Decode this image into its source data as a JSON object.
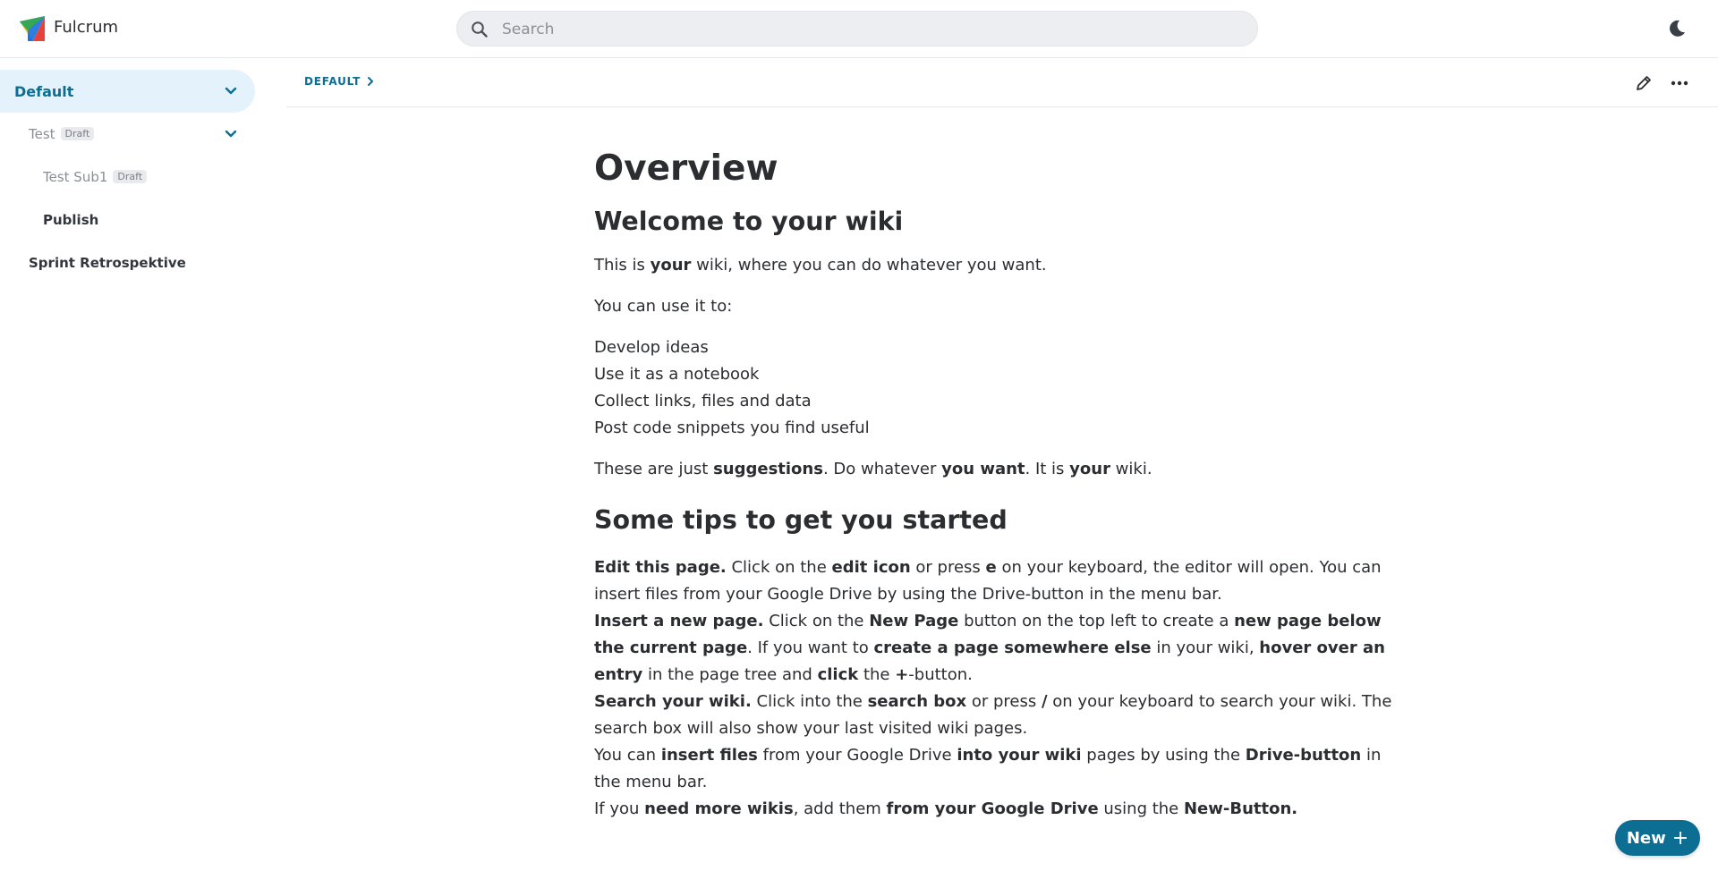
{
  "app": {
    "name": "Fulcrum"
  },
  "search": {
    "placeholder": "Search"
  },
  "sidebar": {
    "items": [
      {
        "label": "Default"
      },
      {
        "label": "Test",
        "badge": "Draft"
      },
      {
        "label": "Test Sub1",
        "badge": "Draft"
      },
      {
        "label": "Publish"
      },
      {
        "label": "Sprint Retrospektive"
      }
    ]
  },
  "breadcrumb": {
    "label": "DEFAULT"
  },
  "page": {
    "title": "Overview",
    "h_welcome": "Welcome to your wiki",
    "p1": [
      "This is ",
      "your",
      " wiki, where you can do whatever you want."
    ],
    "p2": "You can use it to:",
    "list": [
      "Develop ideas",
      "Use it as a notebook",
      "Collect links, files and data",
      "Post code snippets you find useful"
    ],
    "p3": [
      "These are just ",
      "suggestions",
      ". Do whatever ",
      "you want",
      ". It is ",
      "your",
      " wiki."
    ],
    "h_tips": "Some tips to get you started",
    "tip1": [
      "Edit this page.",
      " Click on the ",
      "edit icon",
      " or press ",
      "e",
      " on your keyboard, the editor will open. You can insert files from your Google Drive by using the Drive-button in the menu bar."
    ],
    "tip2": [
      "Insert a new page.",
      " Click on the ",
      "New Page",
      " button on the top left to create a ",
      "new page below the current page",
      ". If you want to ",
      "create a page somewhere else",
      " in your wiki, ",
      "hover over an entry",
      " in the page tree and ",
      "click",
      " the ",
      "+",
      "-button."
    ],
    "tip3": [
      "Search your wiki.",
      " Click into the ",
      "search box",
      " or press ",
      "/",
      " on your keyboard to search your wiki. The search box will also show your last visited wiki pages."
    ],
    "tip4": [
      "You can ",
      "insert files",
      " from your Google Drive ",
      "into your wiki",
      " pages by using the ",
      "Drive-button",
      " in the menu bar."
    ],
    "tip5": [
      "If you ",
      "need more wikis",
      ", add them ",
      "from your Google Drive",
      " using the ",
      "New-Button."
    ]
  },
  "new_button": {
    "label": "New",
    "plus": "+"
  },
  "colors": {
    "accent": "#0d6e94",
    "selected_bg": "#e4f3fb"
  },
  "icons": [
    "fulcrum-logo-icon",
    "search-icon",
    "moon-icon",
    "chevron-down-icon",
    "chevron-right-icon",
    "pencil-icon",
    "more-horizontal-icon"
  ]
}
